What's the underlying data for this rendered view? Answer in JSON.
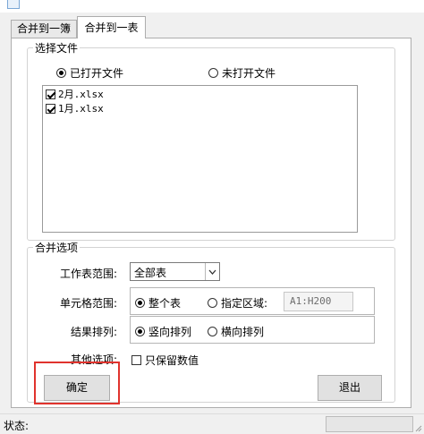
{
  "tabs": [
    {
      "label": "合并到一簿",
      "active": false
    },
    {
      "label": "合并到一表",
      "active": true
    }
  ],
  "select_files": {
    "legend": "选择文件",
    "radio_open": "已打开文件",
    "radio_unopened": "未打开文件",
    "selected": "已打开文件",
    "files": [
      {
        "name": "2月.xlsx",
        "checked": true
      },
      {
        "name": "1月.xlsx",
        "checked": true
      }
    ]
  },
  "merge_options": {
    "legend": "合并选项",
    "sheet_range_label": "工作表范围:",
    "sheet_range_value": "全部表",
    "cell_range_label": "单元格范围:",
    "cell_range_whole": "整个表",
    "cell_range_specified": "指定区域:",
    "cell_range_selected": "整个表",
    "cell_range_value": "A1:H200",
    "result_order_label": "结果排列:",
    "order_vertical": "竖向排列",
    "order_horizontal": "横向排列",
    "order_selected": "竖向排列",
    "other_label": "其他选项:",
    "keep_values_label": "只保留数值",
    "keep_values_checked": false
  },
  "buttons": {
    "ok": "确定",
    "exit": "退出"
  },
  "status": {
    "label": "状态:"
  },
  "colors": {
    "highlight": "#e0332d"
  }
}
